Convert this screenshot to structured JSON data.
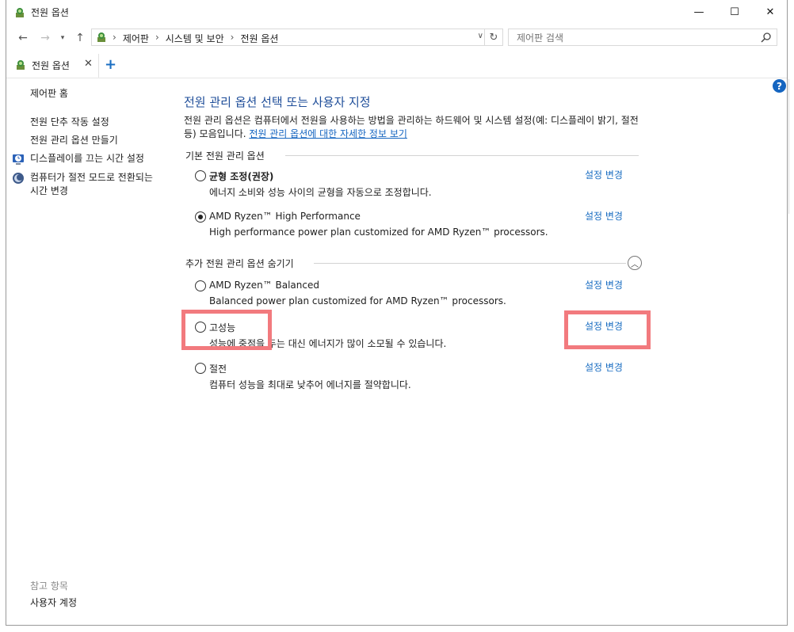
{
  "window": {
    "title": "전원 옵션",
    "controls": {
      "minimize": "—",
      "maximize": "☐",
      "close": "✕"
    }
  },
  "address": {
    "crumbs": [
      "제어판",
      "시스템 및 보안",
      "전원 옵션"
    ],
    "search_placeholder": "제어판 검색"
  },
  "tabs": [
    {
      "label": "전원 옵션",
      "close": "✕"
    }
  ],
  "new_tab": "+",
  "help": "?",
  "sidebar": {
    "home": "제어판 홈",
    "links": [
      "전원 단추 작동 설정",
      "전원 관리 옵션 만들기",
      "디스플레이를 끄는 시간 설정",
      "컴퓨터가 절전 모드로 전환되는 시간 변경"
    ],
    "see_also_title": "참고 항목",
    "see_also": [
      "사용자 계정"
    ]
  },
  "main": {
    "title": "전원 관리 옵션 선택 또는 사용자 지정",
    "description": "전원 관리 옵션은 컴퓨터에서 전원을 사용하는 방법을 관리하는 하드웨어 및 시스템 설정(예: 디스플레이 밝기, 절전 등) 모음입니다. ",
    "description_link": "전원 관리 옵션에 대한 자세한 정보 보기",
    "section_default": "기본 전원 관리 옵션",
    "section_extra": "추가 전원 관리 옵션 숨기기",
    "change_label": "설정 변경",
    "plans_default": [
      {
        "name": "균형 조정(권장)",
        "desc": "에너지 소비와 성능 사이의 균형을 자동으로 조정합니다.",
        "selected": false,
        "bold": true
      },
      {
        "name": "AMD Ryzen™ High Performance",
        "desc": "High performance power plan customized for AMD Ryzen™ processors.",
        "selected": true,
        "bold": false
      }
    ],
    "plans_extra": [
      {
        "name": "AMD Ryzen™ Balanced",
        "desc": "Balanced power plan customized for AMD Ryzen™ processors.",
        "selected": false
      },
      {
        "name": "고성능",
        "desc": "성능에 중점을 두는 대신 에너지가 많이 소모될 수 있습니다.",
        "selected": false
      },
      {
        "name": "절전",
        "desc": "컴퓨터 성능을 최대로 낮추어 에너지를 절약합니다.",
        "selected": false
      }
    ]
  },
  "colors": {
    "highlight": "#f27a7e",
    "link": "#1b6ec2",
    "title": "#1e4d99"
  }
}
